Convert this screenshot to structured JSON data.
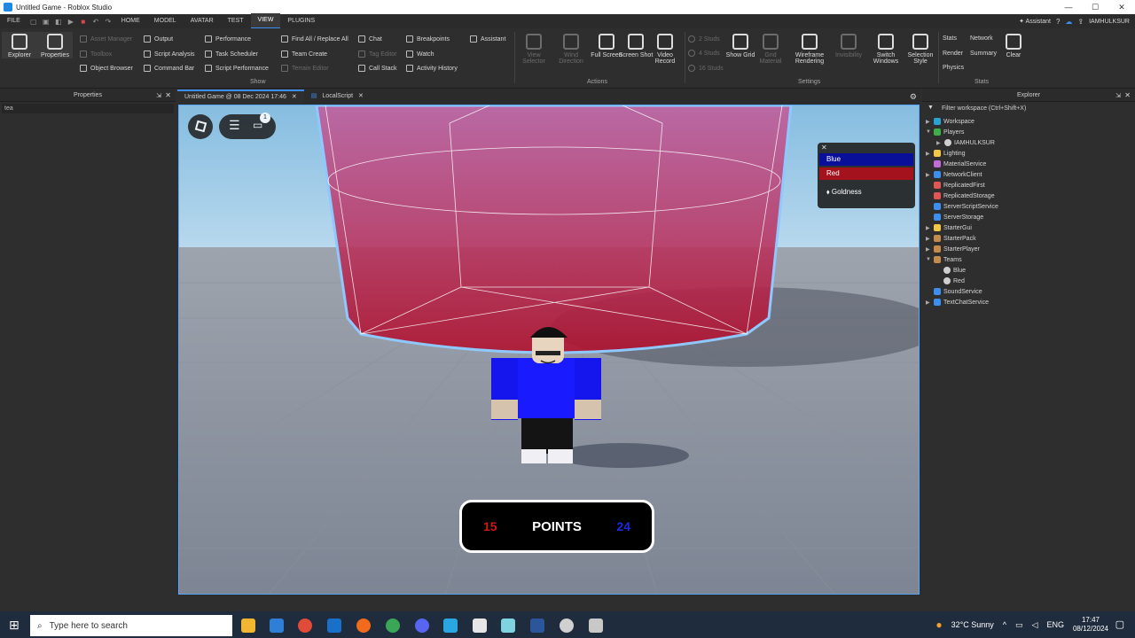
{
  "window": {
    "title": "Untitled Game - Roblox Studio",
    "controls": [
      "—",
      "☐",
      "✕"
    ]
  },
  "menu": {
    "file": "FILE",
    "tabs": [
      "HOME",
      "MODEL",
      "AVATAR",
      "TEST",
      "VIEW",
      "PLUGINS"
    ],
    "active": "VIEW",
    "assistant": "Assistant",
    "user": "IAMHULKSUR"
  },
  "ribbon": {
    "show": {
      "explorer": "Explorer",
      "properties": "Properties",
      "asset_manager": "Asset Manager",
      "toolbox": "Toolbox",
      "object_browser": "Object Browser",
      "output": "Output",
      "script_analysis": "Script Analysis",
      "command_bar": "Command Bar",
      "performance": "Performance",
      "task_scheduler": "Task Scheduler",
      "script_performance": "Script Performance",
      "find_all": "Find All / Replace All",
      "team_create": "Team Create",
      "terrain_editor": "Terrain Editor",
      "chat": "Chat",
      "tag_editor": "Tag Editor",
      "call_stack": "Call Stack",
      "breakpoints": "Breakpoints",
      "watch": "Watch",
      "activity_history": "Activity History",
      "assistant": "Assistant",
      "label": "Show"
    },
    "actions": {
      "view_selector": "View Selector",
      "wind_direction": "Wind Direction",
      "full_screen": "Full Screen",
      "screen_shot": "Screen Shot",
      "video_record": "Video Record",
      "label": "Actions"
    },
    "settings": {
      "studs_2": "2 Studs",
      "studs_4": "4 Studs",
      "studs_16": "16 Studs",
      "show_grid": "Show Grid",
      "grid_material": "Grid Material",
      "wireframe": "Wireframe Rendering",
      "invisibility": "Invisibility",
      "switch_windows": "Switch Windows",
      "selection_style": "Selection Style",
      "label": "Settings"
    },
    "stats": {
      "stats": "Stats",
      "network": "Network",
      "render": "Render",
      "summary": "Summary",
      "physics": "Physics",
      "clear": "Clear",
      "label": "Stats"
    }
  },
  "properties": {
    "title": "Properties",
    "filter": "tea"
  },
  "tabs": [
    {
      "label": "Untitled Game @ 08 Dec 2024 17:46"
    },
    {
      "label": "LocalScript"
    }
  ],
  "explorer": {
    "title": "Explorer",
    "filter": "Filter workspace (Ctrl+Shift+X)",
    "items": [
      {
        "label": "Workspace",
        "color": "#29a3d6"
      },
      {
        "label": "Players",
        "color": "#3fae4a"
      },
      {
        "label": "IAMHULKSUR",
        "color": "#cfcfcf"
      },
      {
        "label": "Lighting",
        "color": "#f2c744"
      },
      {
        "label": "MaterialService",
        "color": "#c06bd8"
      },
      {
        "label": "NetworkClient",
        "color": "#3c8ef0"
      },
      {
        "label": "ReplicatedFirst",
        "color": "#e25555"
      },
      {
        "label": "ReplicatedStorage",
        "color": "#e25555"
      },
      {
        "label": "ServerScriptService",
        "color": "#3c8ef0"
      },
      {
        "label": "ServerStorage",
        "color": "#3c8ef0"
      },
      {
        "label": "StarterGui",
        "color": "#f2c744"
      },
      {
        "label": "StarterPack",
        "color": "#c48b4a"
      },
      {
        "label": "StarterPlayer",
        "color": "#c48b4a"
      },
      {
        "label": "Teams",
        "color": "#c48b4a"
      },
      {
        "label": "Blue",
        "color": "#cfcfcf"
      },
      {
        "label": "Red",
        "color": "#cfcfcf"
      },
      {
        "label": "SoundService",
        "color": "#3c8ef0"
      },
      {
        "label": "TextChatService",
        "color": "#3c8ef0"
      }
    ]
  },
  "game": {
    "chat_badge": "1",
    "teams": [
      {
        "name": "Blue",
        "color": "#0a0f9a"
      },
      {
        "name": "Red",
        "color": "#a3121d"
      }
    ],
    "player_entry": "Goldness",
    "scoreboard": {
      "red_score": "15",
      "label": "POINTS",
      "blue_score": "24"
    }
  },
  "taskbar": {
    "search_placeholder": "Type here to search",
    "weather": "32°C  Sunny",
    "lang": "ENG",
    "time": "17:47",
    "date": "08/12/2024"
  }
}
